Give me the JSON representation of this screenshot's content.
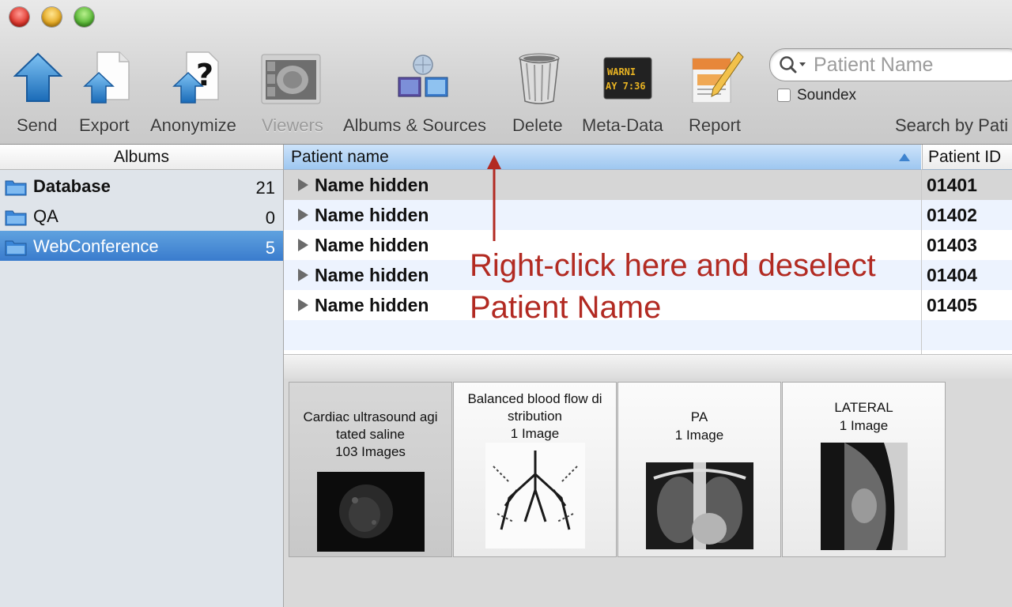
{
  "window": {
    "traffic_lights": [
      "close",
      "minimize",
      "zoom"
    ]
  },
  "toolbar": {
    "buttons": [
      {
        "label": "Send",
        "icon": "send-icon"
      },
      {
        "label": "Export",
        "icon": "export-icon"
      },
      {
        "label": "Anonymize",
        "icon": "anonymize-icon"
      },
      {
        "label": "Viewers",
        "icon": "viewers-icon",
        "disabled": true
      },
      {
        "label": "Albums & Sources",
        "icon": "albums-sources-icon"
      },
      {
        "label": "Delete",
        "icon": "trash-icon"
      },
      {
        "label": "Meta-Data",
        "icon": "meta-data-icon"
      },
      {
        "label": "Report",
        "icon": "report-icon"
      }
    ],
    "search": {
      "placeholder": "Patient Name",
      "soundex_label": "Soundex",
      "soundex_checked": false,
      "caption": "Search by Pati"
    },
    "meta_icon_text": "WARNI AY 7:36"
  },
  "sidebar": {
    "header": "Albums",
    "albums": [
      {
        "name": "Database",
        "count": "21",
        "bold": true
      },
      {
        "name": "QA",
        "count": "0"
      },
      {
        "name": "WebConference",
        "count": "5",
        "selected": true
      }
    ]
  },
  "list": {
    "columns": [
      "Patient name",
      "Patient ID"
    ],
    "rows": [
      {
        "name": "Name hidden",
        "id": "01401"
      },
      {
        "name": "Name hidden",
        "id": "01402"
      },
      {
        "name": "Name hidden",
        "id": "01403"
      },
      {
        "name": "Name hidden",
        "id": "01404"
      },
      {
        "name": "Name hidden",
        "id": "01405"
      }
    ]
  },
  "annotation": {
    "line1": "Right-click here and deselect",
    "line2": "Patient Name",
    "color": "#b22a22"
  },
  "thumbnails": [
    {
      "title_lines": [
        "Cardiac ultrasound agi",
        "tated saline"
      ],
      "count": "103 Images"
    },
    {
      "title_lines": [
        "Balanced blood flow di",
        "stribution"
      ],
      "count": "1 Image"
    },
    {
      "title_lines": [
        "PA"
      ],
      "count": "1 Image"
    },
    {
      "title_lines": [
        "LATERAL"
      ],
      "count": "1 Image"
    }
  ],
  "colors": {
    "selection": "#3a7ccd",
    "header_selected": "#9ec7f0",
    "annotation": "#b22a22"
  }
}
